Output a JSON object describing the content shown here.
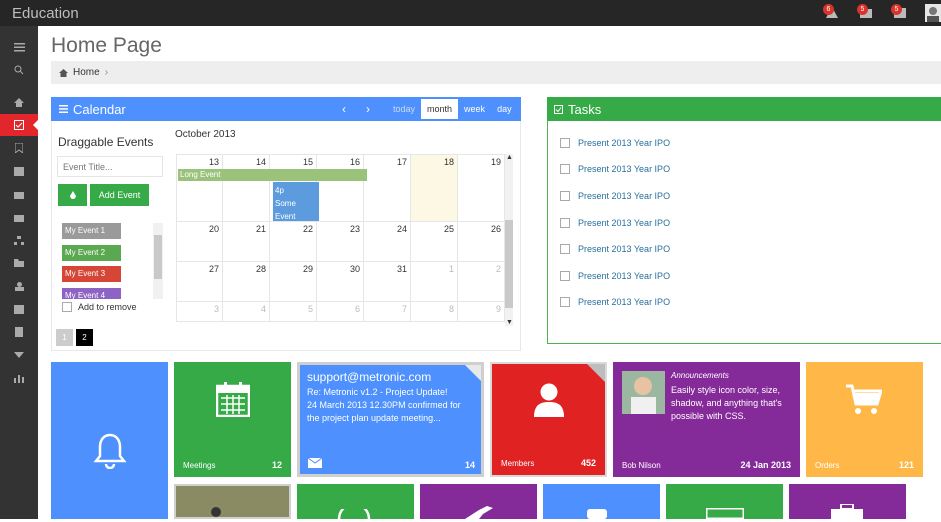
{
  "app": {
    "brand": "Education"
  },
  "header": {
    "badges": [
      "6",
      "5",
      "5"
    ]
  },
  "page": {
    "title": "Home Page"
  },
  "breadcrumb": {
    "items": [
      "Home"
    ]
  },
  "calendar": {
    "title": "Calendar",
    "views": [
      "today",
      "month",
      "week",
      "day"
    ],
    "active_view": "month",
    "month_label": "October 2013",
    "draggable_title": "Draggable Events",
    "event_title_placeholder": "Event Title...",
    "add_event": "Add Event",
    "events": [
      {
        "label": "My Event 1",
        "color": "#9a9a9a"
      },
      {
        "label": "My Event 2",
        "color": "#5aa84f"
      },
      {
        "label": "My Event 3",
        "color": "#d64637"
      },
      {
        "label": "My Event 4",
        "color": "#8d63c4"
      }
    ],
    "remove_label": "Add to remove",
    "pages": [
      "1",
      "2"
    ],
    "weeks": [
      [
        "13",
        "14",
        "15",
        "16",
        "17",
        "18",
        "19"
      ],
      [
        "20",
        "21",
        "22",
        "23",
        "24",
        "25",
        "26"
      ],
      [
        "27",
        "28",
        "29",
        "30",
        "31",
        "1",
        "2"
      ],
      [
        "3",
        "4",
        "5",
        "6",
        "7",
        "8",
        "9"
      ]
    ],
    "long_event": "Long Event",
    "event_small": {
      "time": "4p",
      "title": "Some Event"
    }
  },
  "tasks": {
    "title": "Tasks",
    "items": [
      "Present 2013 Year IPO",
      "Present 2013 Year IPO",
      "Present 2013 Year IPO",
      "Present 2013 Year IPO",
      "Present 2013 Year IPO",
      "Present 2013 Year IPO",
      "Present 2013 Year IPO"
    ]
  },
  "tiles": {
    "meetings": {
      "label": "Meetings",
      "count": "12"
    },
    "mail": {
      "title": "support@metronic.com",
      "subject": "Re: Metronic v1.2 - Project Update!",
      "body": "24 March 2013 12.30PM confirmed for the project plan update meeting...",
      "count": "14"
    },
    "members": {
      "label": "Members",
      "count": "452"
    },
    "announce": {
      "kicker": "Announcements",
      "text": "Easily style icon color, size, shadow, and anything that's possible with CSS.",
      "author": "Bob Nilson",
      "date": "24 Jan 2013"
    },
    "orders": {
      "label": "Orders",
      "count": "121"
    }
  },
  "colors": {
    "blue": "#4d90fe",
    "green": "#35aa47",
    "red": "#e02222",
    "purple": "#852b99",
    "orange": "#ffb848"
  }
}
